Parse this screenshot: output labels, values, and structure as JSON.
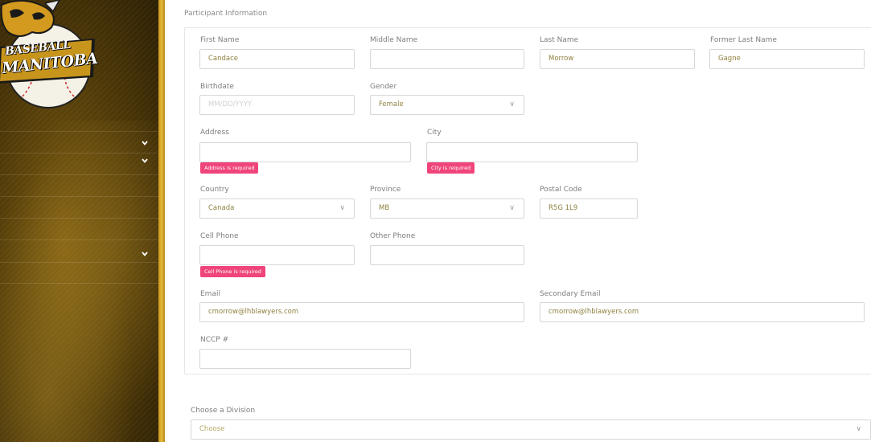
{
  "logo": {
    "line1": "BASEBALL",
    "line2": "MANITOBA"
  },
  "sidebar": {
    "chevrons": [
      "chevron-down-icon",
      "chevron-down-icon",
      "chevron-down-icon"
    ]
  },
  "section": {
    "title": "Participant Information"
  },
  "fields": {
    "first_name": {
      "label": "First Name",
      "value": "Candace"
    },
    "middle_name": {
      "label": "Middle Name",
      "value": ""
    },
    "last_name": {
      "label": "Last Name",
      "value": "Morrow"
    },
    "former_last_name": {
      "label": "Former Last Name",
      "value": "Gagne"
    },
    "birthdate": {
      "label": "Birthdate",
      "placeholder": "MM/DD/YYYY"
    },
    "gender": {
      "label": "Gender",
      "value": "Female"
    },
    "address": {
      "label": "Address",
      "value": "",
      "error": "Address is required"
    },
    "city": {
      "label": "City",
      "value": "",
      "error": "City is required"
    },
    "country": {
      "label": "Country",
      "value": "Canada"
    },
    "province": {
      "label": "Province",
      "value": "MB"
    },
    "postal_code": {
      "label": "Postal Code",
      "value": "R5G 1L9"
    },
    "cell_phone": {
      "label": "Cell Phone",
      "value": "",
      "error": "Cell Phone is required"
    },
    "other_phone": {
      "label": "Other Phone",
      "value": ""
    },
    "email": {
      "label": "Email",
      "value": "cmorrow@lhblawyers.com"
    },
    "secondary_email": {
      "label": "Secondary Email",
      "value": "cmorrow@lhblawyers.com"
    },
    "nccp": {
      "label": "NCCP #",
      "value": ""
    }
  },
  "division": {
    "label": "Choose a Division",
    "value": "Choose"
  },
  "icons": {
    "select_caret": "∨",
    "nav_chevron": "⌄"
  },
  "colors": {
    "accent_gold": "#e5b83a",
    "error_pink": "#f0457a",
    "value_text": "#8f8240"
  }
}
